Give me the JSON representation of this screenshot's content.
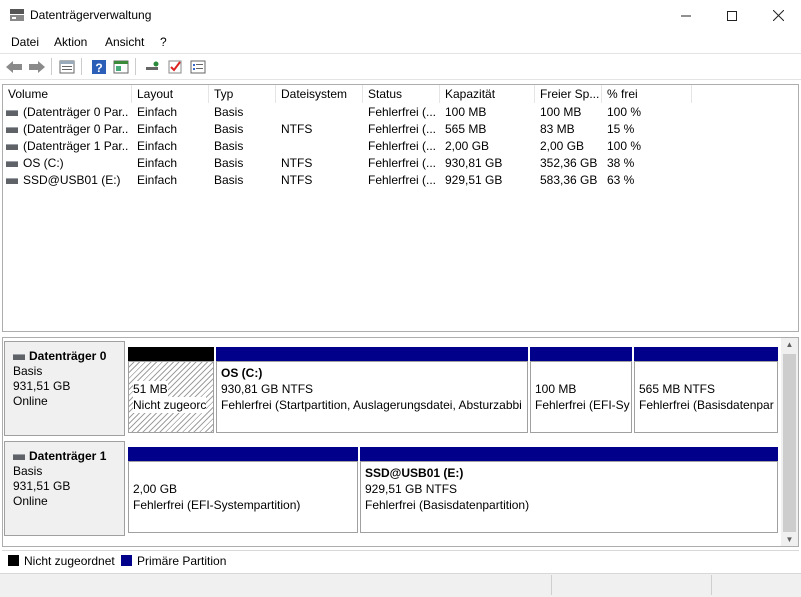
{
  "window": {
    "title": "Datenträgerverwaltung",
    "minimize_icon": "minimize-icon",
    "maximize_icon": "maximize-icon",
    "close_icon": "close-icon"
  },
  "menu": [
    "Datei",
    "Aktion",
    "Ansicht",
    "?"
  ],
  "toolbar": [
    "back-icon",
    "forward-icon",
    "properties-icon",
    "help-icon",
    "console-icon",
    "connect-icon",
    "check-icon",
    "list-icon"
  ],
  "table": {
    "columns": [
      "Volume",
      "Layout",
      "Typ",
      "Dateisystem",
      "Status",
      "Kapazität",
      "Freier Sp...",
      "% frei"
    ],
    "rows": [
      [
        "(Datenträger 0 Par...",
        "Einfach",
        "Basis",
        "",
        "Fehlerfrei (...",
        "100 MB",
        "100 MB",
        "100 %"
      ],
      [
        "(Datenträger 0 Par...",
        "Einfach",
        "Basis",
        "NTFS",
        "Fehlerfrei (...",
        "565 MB",
        "83 MB",
        "15 %"
      ],
      [
        "(Datenträger 1 Par...",
        "Einfach",
        "Basis",
        "",
        "Fehlerfrei (...",
        "2,00 GB",
        "2,00 GB",
        "100 %"
      ],
      [
        "OS (C:)",
        "Einfach",
        "Basis",
        "NTFS",
        "Fehlerfrei (...",
        "930,81 GB",
        "352,36 GB",
        "38 %"
      ],
      [
        "SSD@USB01 (E:)",
        "Einfach",
        "Basis",
        "NTFS",
        "Fehlerfrei (...",
        "929,51 GB",
        "583,36 GB",
        "63 %"
      ]
    ]
  },
  "disks": [
    {
      "name": "Datenträger 0",
      "type": "Basis",
      "size": "931,51 GB",
      "state": "Online",
      "partitions": [
        {
          "title": "",
          "line1": "51 MB",
          "line2": "Nicht zugeorc"
        },
        {
          "title": "OS  (C:)",
          "line1": "930,81 GB NTFS",
          "line2": "Fehlerfrei (Startpartition, Auslagerungsdatei, Absturzabbi"
        },
        {
          "title": "",
          "line1": "100 MB",
          "line2": "Fehlerfrei (EFI-Sy"
        },
        {
          "title": "",
          "line1": "565 MB NTFS",
          "line2": "Fehlerfrei (Basisdatenpar"
        }
      ]
    },
    {
      "name": "Datenträger 1",
      "type": "Basis",
      "size": "931,51 GB",
      "state": "Online",
      "partitions": [
        {
          "title": "",
          "line1": "2,00 GB",
          "line2": "Fehlerfrei (EFI-Systempartition)"
        },
        {
          "title": "SSD@USB01  (E:)",
          "line1": "929,51 GB NTFS",
          "line2": "Fehlerfrei (Basisdatenpartition)"
        }
      ]
    }
  ],
  "legend": [
    {
      "label": "Nicht zugeordnet",
      "color": "#000000"
    },
    {
      "label": "Primäre Partition",
      "color": "#00008b"
    }
  ]
}
